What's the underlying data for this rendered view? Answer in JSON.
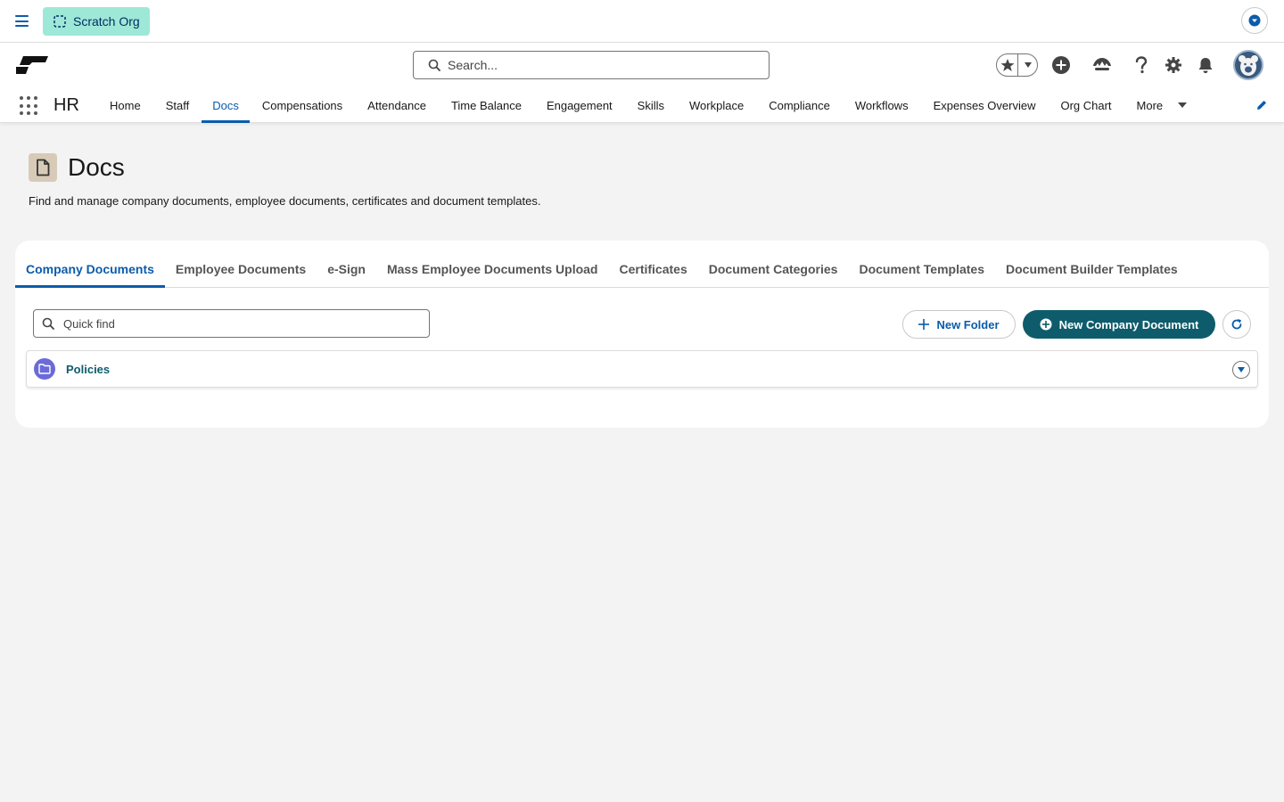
{
  "topbar": {
    "org_label": "Scratch Org"
  },
  "header": {
    "search_placeholder": "Search...",
    "icons": [
      "star-icon",
      "add-icon",
      "trailhead-icon",
      "help-icon",
      "setup-gear-icon",
      "notification-bell-icon"
    ]
  },
  "nav": {
    "app_name": "HR",
    "items": [
      {
        "label": "Home"
      },
      {
        "label": "Staff"
      },
      {
        "label": "Docs",
        "active": true
      },
      {
        "label": "Compensations"
      },
      {
        "label": "Attendance"
      },
      {
        "label": "Time Balance"
      },
      {
        "label": "Engagement"
      },
      {
        "label": "Skills"
      },
      {
        "label": "Workplace"
      },
      {
        "label": "Compliance"
      },
      {
        "label": "Workflows"
      },
      {
        "label": "Expenses Overview"
      },
      {
        "label": "Org Chart"
      }
    ],
    "more_label": "More"
  },
  "page": {
    "title": "Docs",
    "description": "Find and manage company documents, employee documents, certificates and document templates."
  },
  "tabs": [
    {
      "label": "Company Documents",
      "active": true
    },
    {
      "label": "Employee Documents"
    },
    {
      "label": "e-Sign"
    },
    {
      "label": "Mass Employee Documents Upload"
    },
    {
      "label": "Certificates"
    },
    {
      "label": "Document Categories"
    },
    {
      "label": "Document Templates"
    },
    {
      "label": "Document Builder Templates"
    }
  ],
  "toolbar": {
    "quick_find_placeholder": "Quick find",
    "new_folder_label": "New Folder",
    "new_document_label": "New Company Document"
  },
  "folders": [
    {
      "name": "Policies"
    }
  ],
  "colors": {
    "brand_blue": "#0b5cab",
    "teal_button": "#0e5c6b",
    "org_badge": "#9ee8d8",
    "folder_icon": "#6b6ad9",
    "page_icon": "#d7cbb8"
  }
}
